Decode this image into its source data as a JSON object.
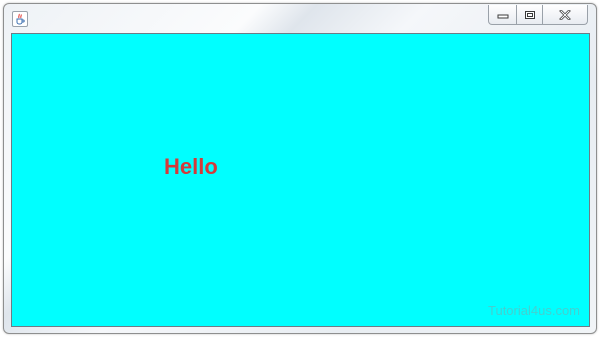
{
  "window": {
    "title": ""
  },
  "content": {
    "label_text": "Hello",
    "background_color": "#00ffff",
    "label_color": "#d43a3a"
  },
  "watermark": {
    "text": "Tutorial4us.com"
  },
  "icons": {
    "app": "java-cup-icon",
    "minimize": "minimize-icon",
    "maximize": "maximize-icon",
    "close": "close-icon"
  }
}
